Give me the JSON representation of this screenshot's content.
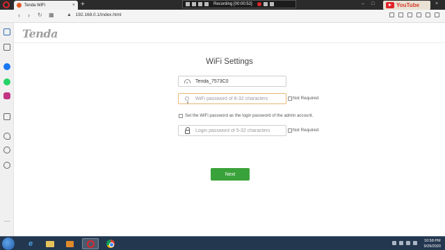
{
  "browser": {
    "tab_title": "Tenda WiFi",
    "tab_close": "×",
    "new_tab": "+",
    "url": "192.168.0.1/index.html"
  },
  "recorder": {
    "status": "Recording [00:00:52]"
  },
  "window_controls": {
    "minimize": "–",
    "maximize": "□",
    "close": "×"
  },
  "watermark": {
    "text": "YouTube"
  },
  "page": {
    "logo": "Tenda",
    "title": "WiFi Settings",
    "ssid_value": "Tenda_7573C0",
    "wifi_password_placeholder": "WiFi password of 8-32 characters",
    "not_required_label": "Not Required",
    "same_password_label": "Set the WiFi password as the login password of the admin account.",
    "login_password_placeholder": "Login password of 5-32 characters",
    "next_label": "Next"
  },
  "taskbar": {
    "time": "10:58 PM",
    "date": "9/29/2020"
  },
  "colors": {
    "next_button": "#3aa23a",
    "focus_border": "#e8b675",
    "taskbar": "#23374f"
  }
}
